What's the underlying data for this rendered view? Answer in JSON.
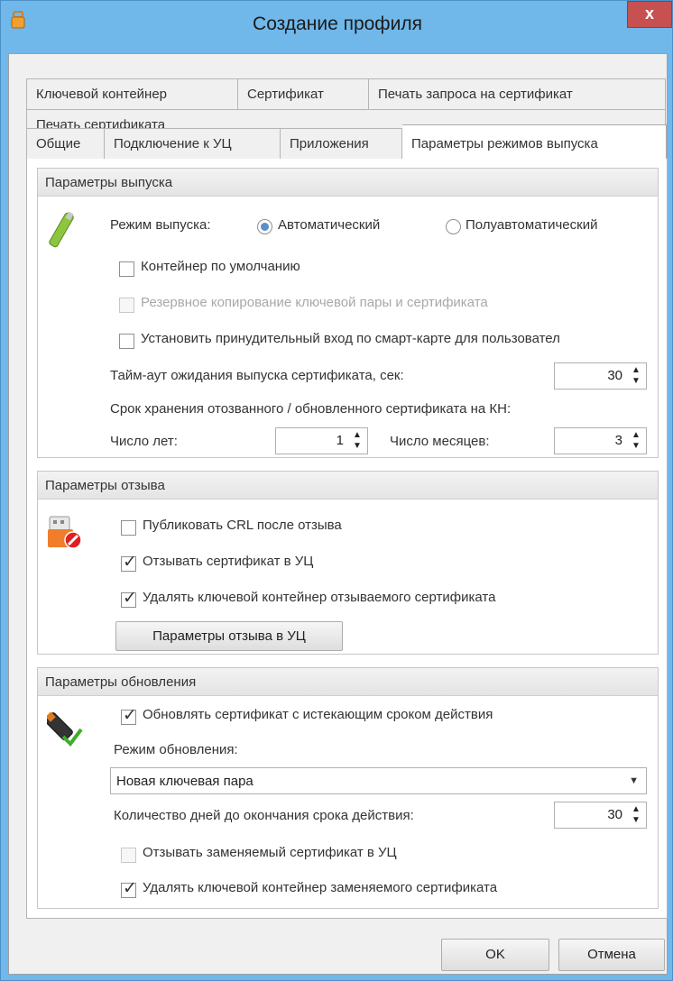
{
  "window": {
    "title": "Создание профиля",
    "close": "x"
  },
  "tabs_row1": [
    "Ключевой контейнер",
    "Сертификат",
    "Печать запроса на сертификат"
  ],
  "tabs_row2": [
    "Печать сертификата"
  ],
  "tabs_row3": [
    "Общие",
    "Подключение к УЦ",
    "Приложения",
    "Параметры режимов выпуска"
  ],
  "active_tab": "Параметры режимов выпуска",
  "issue": {
    "header": "Параметры выпуска",
    "mode_label": "Режим выпуска:",
    "mode_auto": "Автоматический",
    "mode_semi": "Полуавтоматический",
    "mode_selected": "auto",
    "default_container": "Контейнер по умолчанию",
    "backup": "Резервное копирование ключевой пары и сертификата",
    "force_smartcard": "Установить принудительный вход по смарт-карте для пользовател",
    "timeout_label": "Тайм-аут ожидания выпуска сертификата, сек:",
    "timeout_value": "30",
    "retention_label": "Срок хранения отозванного / обновленного сертификата на КН:",
    "years_label": "Число лет:",
    "years_value": "1",
    "months_label": "Число месяцев:",
    "months_value": "3"
  },
  "revoke": {
    "header": "Параметры отзыва",
    "publish_crl": "Публиковать CRL после отзыва",
    "revoke_in_ca": "Отзывать сертификат в УЦ",
    "delete_container": "Удалять ключевой контейнер отзываемого сертификата",
    "params_button": "Параметры отзыва в УЦ"
  },
  "update": {
    "header": "Параметры обновления",
    "update_expiring": "Обновлять сертификат с истекающим сроком действия",
    "mode_label": "Режим обновления:",
    "mode_value": "Новая ключевая пара",
    "days_label": "Количество дней до окончания срока действия:",
    "days_value": "30",
    "revoke_replaced": "Отзывать заменяемый сертификат в УЦ",
    "delete_replaced": "Удалять ключевой контейнер заменяемого сертификата"
  },
  "buttons": {
    "ok": "OK",
    "cancel": "Отмена"
  },
  "colors": {
    "titlebar": "#70b7ea",
    "close": "#c75050",
    "radio": "#5a8fc9"
  }
}
